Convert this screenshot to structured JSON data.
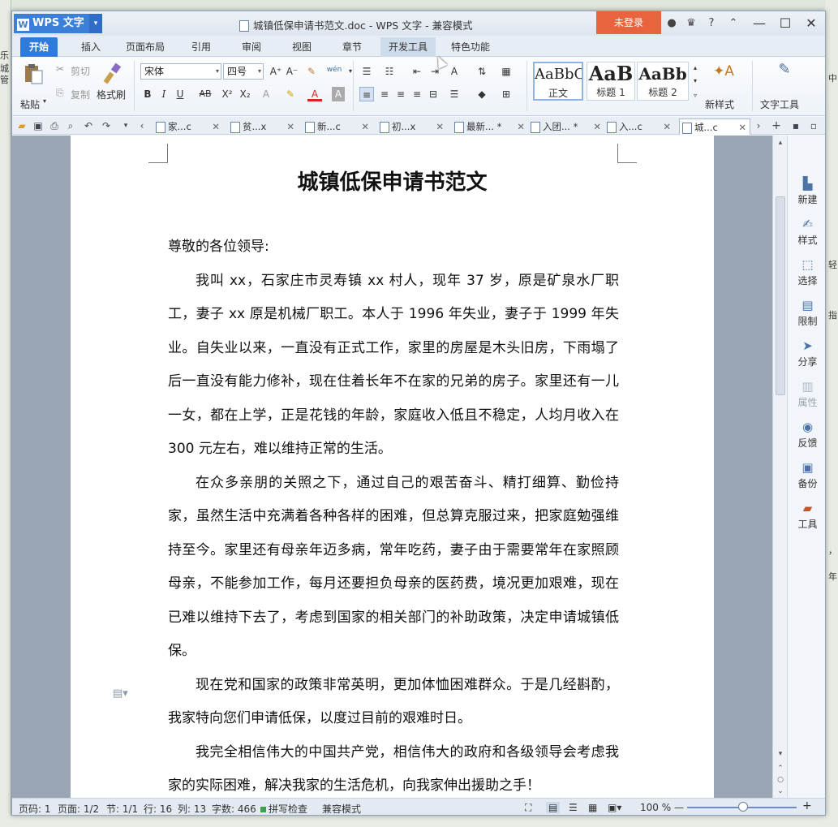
{
  "desktop": {
    "left_fragments": [
      "乐城",
      "管"
    ],
    "right_fragments": [
      "中",
      "轻",
      "指",
      "，",
      "年"
    ]
  },
  "titlebar": {
    "app_name": "WPS 文字",
    "app_badge_dropdown": "▾",
    "document_title": "城镇低保申请书范文.doc - WPS 文字 - 兼容模式",
    "login_label": "未登录",
    "help_label": "?",
    "minimize": "—",
    "maximize": "☐",
    "close": "✕"
  },
  "menu_tabs": [
    {
      "label": "开始"
    },
    {
      "label": "插入"
    },
    {
      "label": "页面布局"
    },
    {
      "label": "引用"
    },
    {
      "label": "审阅"
    },
    {
      "label": "视图"
    },
    {
      "label": "章节"
    },
    {
      "label": "开发工具"
    },
    {
      "label": "特色功能"
    }
  ],
  "ribbon": {
    "paste_label": "粘贴",
    "cut_label": "剪切",
    "copy_label": "复制",
    "format_painter_label": "格式刷",
    "font_name": "宋体",
    "font_size": "四号",
    "pinyin_label": "wén",
    "styles": [
      {
        "sample": "AaBbC",
        "name": "正文"
      },
      {
        "sample": "AaB",
        "name": "标题 1"
      },
      {
        "sample": "AaBb",
        "name": "标题 2"
      }
    ],
    "new_style_label": "新样式",
    "text_tools_label": "文字工具"
  },
  "doc_tabs": [
    {
      "label": "家...c"
    },
    {
      "label": "贫...x"
    },
    {
      "label": "新...c"
    },
    {
      "label": "初...x"
    },
    {
      "label": "最新... *"
    },
    {
      "label": "入团... *"
    },
    {
      "label": "入...c"
    },
    {
      "label": "城...c"
    }
  ],
  "document": {
    "title": "城镇低保申请书范文",
    "salutation": "尊敬的各位领导:",
    "paragraphs": [
      "我叫 xx，石家庄市灵寿镇 xx 村人，现年 37 岁，原是矿泉水厂职工，妻子 xx 原是机械厂职工。本人于 1996 年失业，妻子于 1999 年失业。自失业以来，一直没有正式工作，家里的房屋是木头旧房，下雨塌了后一直没有能力修补，现在住着长年不在家的兄弟的房子。家里还有一儿一女，都在上学，正是花钱的年龄，家庭收入低且不稳定，人均月收入在 300 元左右，难以维持正常的生活。",
      "在众多亲朋的关照之下，通过自己的艰苦奋斗、精打细算、勤俭持家，虽然生活中充满着各种各样的困难，但总算克服过来，把家庭勉强维持至今。家里还有母亲年迈多病，常年吃药，妻子由于需要常年在家照顾母亲，不能参加工作，每月还要担负母亲的医药费，境况更加艰难，现在已难以维持下去了，考虑到国家的相关部门的补助政策，决定申请城镇低保。",
      "现在党和国家的政策非常英明，更加体恤困难群众。于是几经斟酌，我家特向您们申请低保，以度过目前的艰难时日。",
      "我完全相信伟大的中国共产党，相信伟大的政府和各级领导会考虑我家的实际困难，解决我家的生活危机，向我家伸出援助之手！"
    ]
  },
  "side_panel": [
    {
      "label": "新建",
      "icon": "new-doc-icon"
    },
    {
      "label": "样式",
      "icon": "style-icon"
    },
    {
      "label": "选择",
      "icon": "select-icon"
    },
    {
      "label": "限制",
      "icon": "restrict-icon"
    },
    {
      "label": "分享",
      "icon": "share-icon"
    },
    {
      "label": "属性",
      "icon": "properties-icon"
    },
    {
      "label": "反馈",
      "icon": "feedback-icon"
    },
    {
      "label": "备份",
      "icon": "backup-icon"
    },
    {
      "label": "工具",
      "icon": "toolbox-icon"
    }
  ],
  "status": {
    "page_num": "页码: 1",
    "pages": "页面: 1/2",
    "section": "节: 1/1",
    "row": "行: 16",
    "col": "列: 13",
    "word_count": "字数: 466",
    "spell_check": "拼写检查",
    "compat_mode": "兼容模式",
    "zoom": "100 %"
  }
}
